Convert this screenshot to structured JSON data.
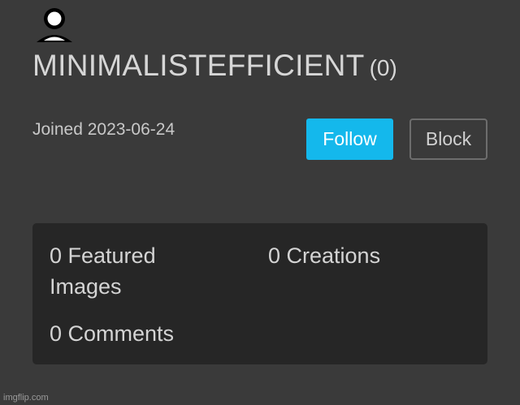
{
  "profile": {
    "avatar_icon": "default-user-avatar-icon",
    "username": "MINIMALISTEFFICIENT",
    "points": "(0)",
    "joined": "Joined 2023-06-24"
  },
  "actions": {
    "follow_label": "Follow",
    "block_label": "Block"
  },
  "stats": {
    "featured_images": "0 Featured Images",
    "creations": "0 Creations",
    "comments": "0 Comments"
  },
  "watermark": "imgflip.com",
  "colors": {
    "background": "#3a3a3a",
    "panel": "#262626",
    "follow_button": "#14b8ec"
  }
}
